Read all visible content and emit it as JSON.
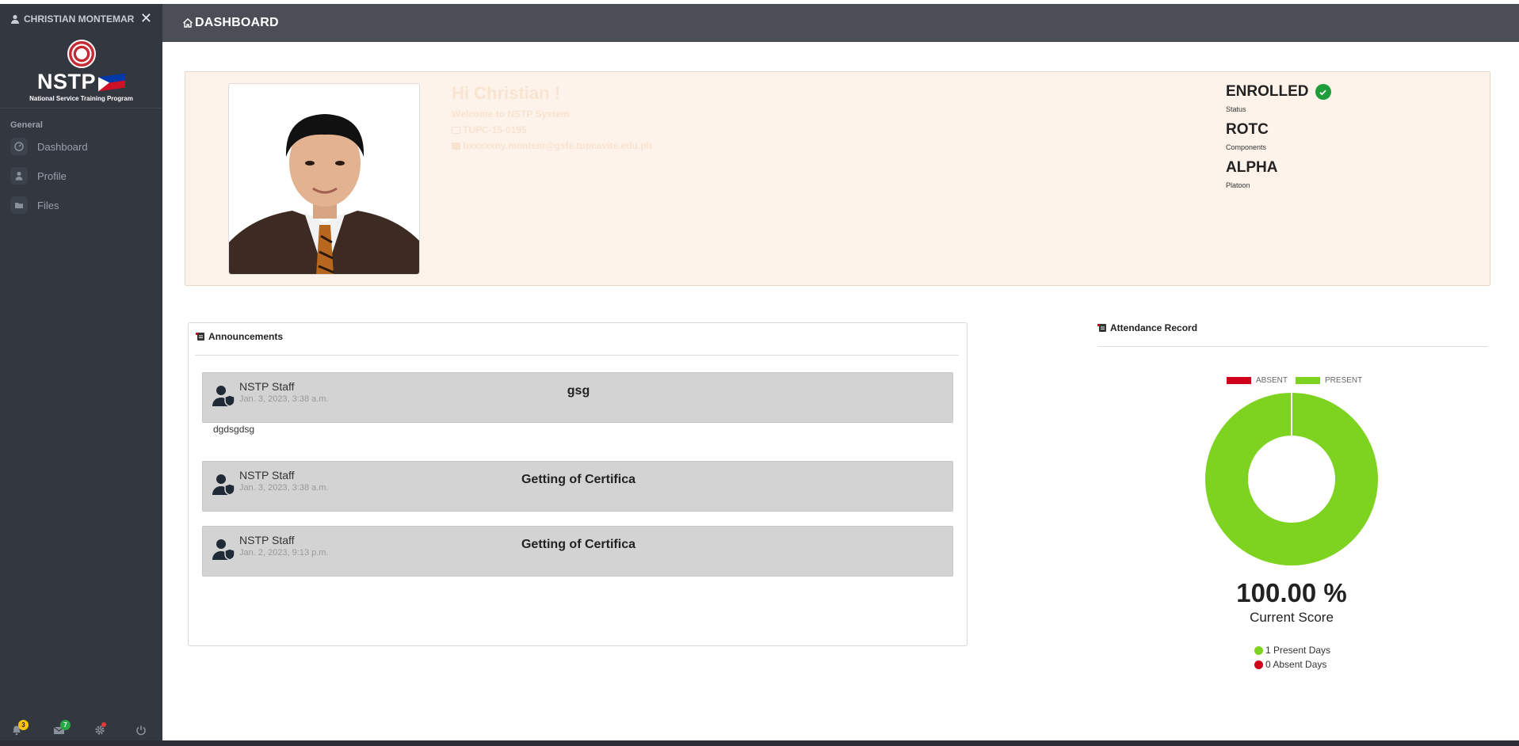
{
  "sidebar": {
    "user_name": "CHRISTIAN MONTEMAR",
    "logo_text": "NSTP",
    "logo_subtitle": "National Service Training Program",
    "section_label": "General",
    "items": [
      {
        "label": "Dashboard",
        "icon": "dashboard-icon"
      },
      {
        "label": "Profile",
        "icon": "user-icon"
      },
      {
        "label": "Files",
        "icon": "folder-icon"
      }
    ],
    "notifications_count": "3",
    "messages_count": "7"
  },
  "header": {
    "title": "DASHBOARD"
  },
  "profile": {
    "greeting": "Hi Christian !",
    "welcome": "Welcome to NSTP System",
    "student_id": "TUPC-15-0195",
    "email": "bxxxxxny.montem@gsfe.tupcavite.edu.ph",
    "status_value": "ENROLLED",
    "status_label": "Status",
    "component_value": "ROTC",
    "component_label": "Components",
    "platoon_value": "ALPHA",
    "platoon_label": "Platoon"
  },
  "announcements": {
    "title": "Announcements",
    "items": [
      {
        "author": "NSTP Staff",
        "date": "Jan. 3, 2023, 3:38 a.m.",
        "subject": "gsg",
        "body": "dgdsgdsg"
      },
      {
        "author": "NSTP Staff",
        "date": "Jan. 3, 2023, 3:38 a.m.",
        "subject": "Getting of Certifica",
        "body": ""
      },
      {
        "author": "NSTP Staff",
        "date": "Jan. 2, 2023, 9:13 p.m.",
        "subject": "Getting of Certifica",
        "body": ""
      }
    ]
  },
  "attendance": {
    "title": "Attendance Record",
    "legend_absent": "ABSENT",
    "legend_present": "PRESENT",
    "score": "100.00 %",
    "score_label": "Current Score",
    "present_days_text": "1 Present Days",
    "absent_days_text": "0 Absent Days",
    "colors": {
      "present": "#7ed321",
      "absent": "#d0021b"
    }
  },
  "chart_data": {
    "type": "pie",
    "categories": [
      "ABSENT",
      "PRESENT"
    ],
    "values": [
      0,
      1
    ]
  }
}
